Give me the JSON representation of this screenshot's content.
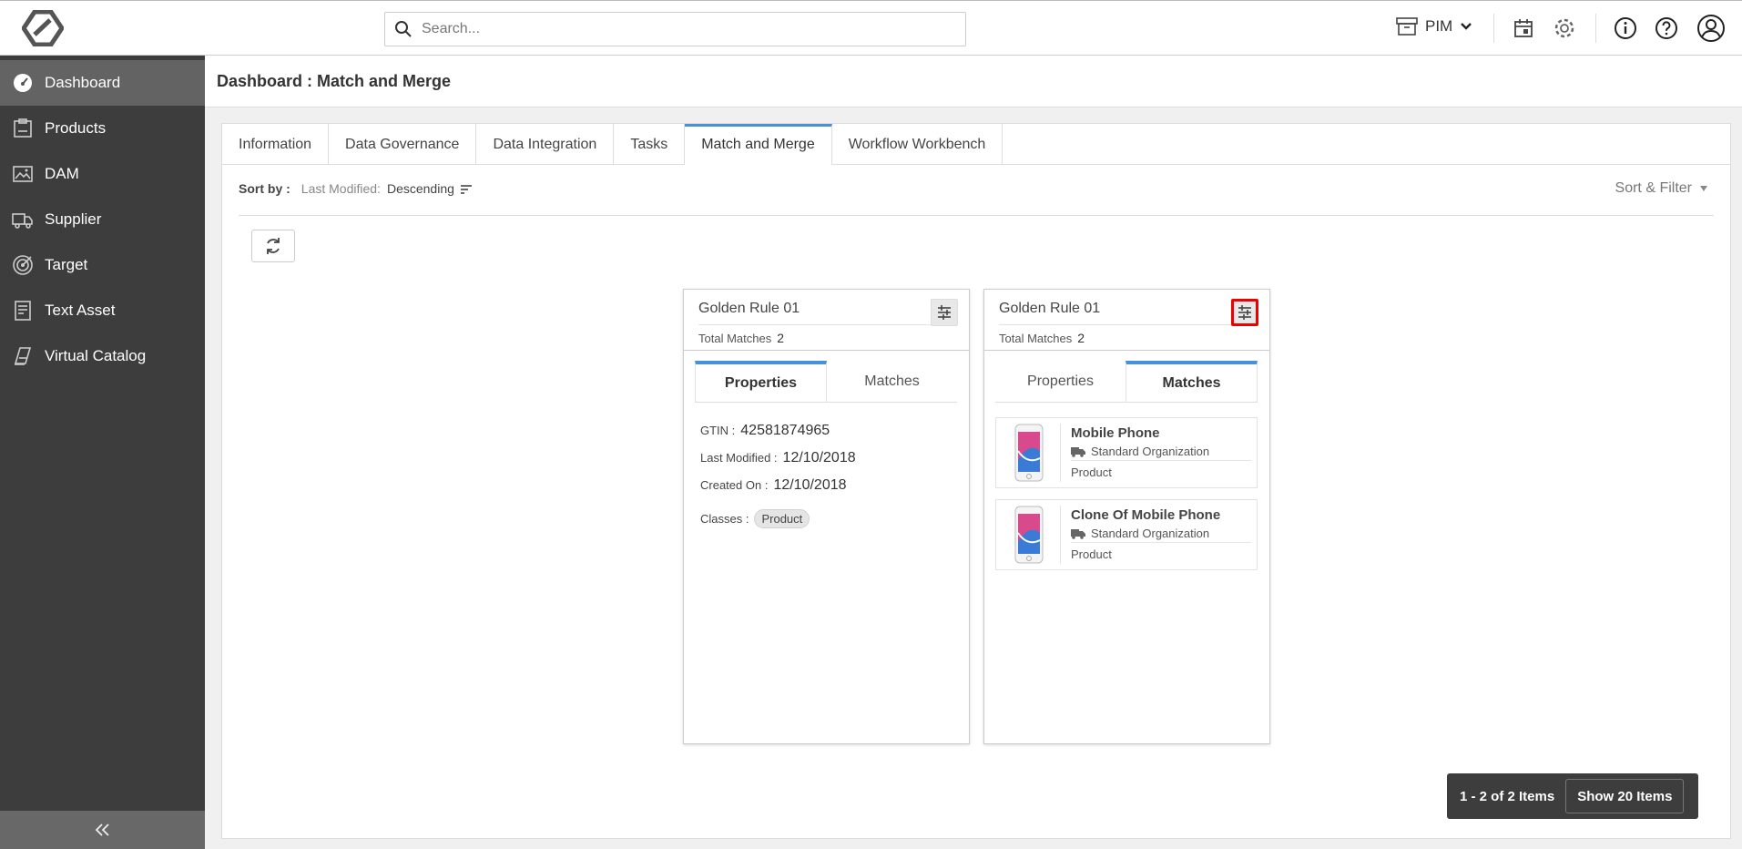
{
  "topbar": {
    "search_placeholder": "Search...",
    "module": "PIM"
  },
  "sidebar": {
    "items": [
      {
        "label": "Dashboard",
        "icon": "dashboard-icon",
        "active": true
      },
      {
        "label": "Products",
        "icon": "products-icon"
      },
      {
        "label": "DAM",
        "icon": "dam-icon"
      },
      {
        "label": "Supplier",
        "icon": "truck-icon"
      },
      {
        "label": "Target",
        "icon": "target-icon"
      },
      {
        "label": "Text Asset",
        "icon": "text-asset-icon"
      },
      {
        "label": "Virtual Catalog",
        "icon": "virtual-catalog-icon"
      }
    ]
  },
  "page": {
    "title": "Dashboard : Match and Merge"
  },
  "tabs": [
    "Information",
    "Data Governance",
    "Data Integration",
    "Tasks",
    "Match and Merge",
    "Workflow Workbench"
  ],
  "active_tab": "Match and Merge",
  "sort": {
    "label": "Sort by :",
    "field": "Last Modified:",
    "order": "Descending",
    "filter_label": "Sort & Filter"
  },
  "cards": [
    {
      "title": "Golden Rule 01",
      "total_label": "Total Matches",
      "total": "2",
      "tab_properties": "Properties",
      "tab_matches": "Matches",
      "active_tab": "Properties",
      "properties": [
        {
          "key": "GTIN :",
          "value": "42581874965"
        },
        {
          "key": "Last Modified :",
          "value": "12/10/2018"
        },
        {
          "key": "Created On :",
          "value": "12/10/2018"
        }
      ],
      "classes_label": "Classes :",
      "classes_value": "Product"
    },
    {
      "title": "Golden Rule 01",
      "total_label": "Total Matches",
      "total": "2",
      "tab_properties": "Properties",
      "tab_matches": "Matches",
      "active_tab": "Matches",
      "matches": [
        {
          "name": "Mobile Phone",
          "org": "Standard Organization",
          "type": "Product"
        },
        {
          "name": "Clone Of Mobile Phone",
          "org": "Standard Organization",
          "type": "Product"
        }
      ]
    }
  ],
  "pager": {
    "count": "1 - 2 of 2 Items",
    "show": "Show 20 Items"
  },
  "colors": {
    "sidebar_bg": "#3d3d3d",
    "sidebar_active": "#636363",
    "accent": "#4a90d9",
    "highlight": "#e00000"
  }
}
